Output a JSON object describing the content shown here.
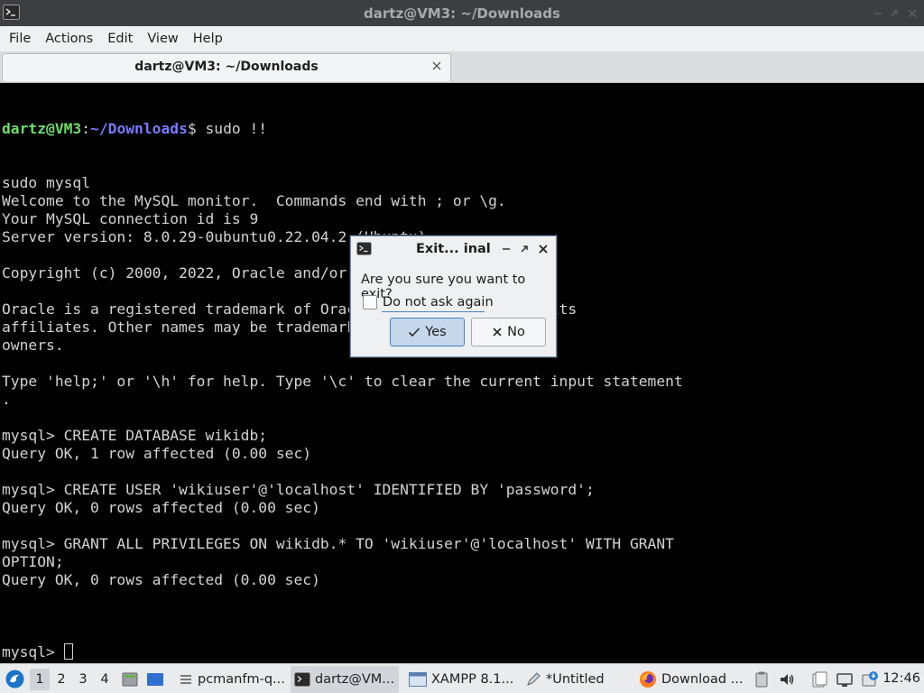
{
  "window": {
    "title": "dartz@VM3: ~/Downloads"
  },
  "menubar": {
    "items": [
      "File",
      "Actions",
      "Edit",
      "View",
      "Help"
    ]
  },
  "tab": {
    "label": "dartz@VM3: ~/Downloads"
  },
  "terminal": {
    "prompt_user": "dartz@VM3",
    "prompt_sep": ":",
    "prompt_path": "~/Downloads",
    "prompt_cmd": "$ sudo !!",
    "lines": [
      "sudo mysql",
      "Welcome to the MySQL monitor.  Commands end with ; or \\g.",
      "Your MySQL connection id is 9",
      "Server version: 8.0.29-0ubuntu0.22.04.2 (Ubuntu)",
      "",
      "Copyright (c) 2000, 2022, Oracle and/or its affiliates.",
      "",
      "Oracle is a registered trademark of Oracle Corporation and/or its",
      "affiliates. Other names may be trademarks of their respective",
      "owners.",
      "",
      "Type 'help;' or '\\h' for help. Type '\\c' to clear the current input statement",
      ".",
      "",
      "mysql> CREATE DATABASE wikidb;",
      "Query OK, 1 row affected (0.00 sec)",
      "",
      "mysql> CREATE USER 'wikiuser'@'localhost' IDENTIFIED BY 'password';",
      "Query OK, 0 rows affected (0.00 sec)",
      "",
      "mysql> GRANT ALL PRIVILEGES ON wikidb.* TO 'wikiuser'@'localhost' WITH GRANT",
      "OPTION;",
      "Query OK, 0 rows affected (0.00 sec)",
      ""
    ],
    "final_prompt": "mysql> "
  },
  "dialog": {
    "title": "Exit... inal",
    "question": "Are you sure you want to exit?",
    "checkbox_label": "Do not ask again",
    "yes_label": "Yes",
    "no_label": "No"
  },
  "taskbar": {
    "workspaces": [
      "1",
      "2",
      "3",
      "4"
    ],
    "tasks": [
      {
        "label": "pcmanfm-q...",
        "icon": "file-manager-icon"
      },
      {
        "label": "dartz@VM...",
        "icon": "terminal-icon"
      },
      {
        "label": "XAMPP 8.1...",
        "icon": "window-icon"
      },
      {
        "label": "*Untitled",
        "icon": "text-editor-icon"
      },
      {
        "label": "Download ...",
        "icon": "firefox-icon"
      }
    ],
    "clock": "12:46"
  }
}
